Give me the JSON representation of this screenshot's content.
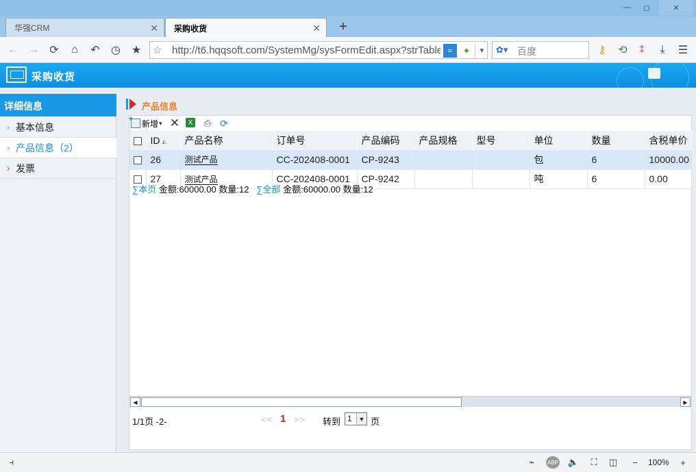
{
  "window": {
    "controls": {
      "minimize": "—",
      "maximize": "◻",
      "close": "✕"
    }
  },
  "tabs": [
    {
      "label": "华强CRM",
      "active": false
    },
    {
      "label": "采购收货",
      "active": true
    }
  ],
  "tab_add": "+",
  "tab_close": "✕",
  "address": {
    "url": "http://t6.hqqsoft.com/SystemMg/sysFormEdit.aspx?strTableName=",
    "search_placeholder": "百度"
  },
  "banner": {
    "title": "采购收货"
  },
  "sidebar": {
    "header": "详细信息",
    "items": [
      {
        "label": "基本信息",
        "active": false
      },
      {
        "label": "产品信息（2）",
        "active": true
      },
      {
        "label": "发票",
        "active": false
      }
    ]
  },
  "section": {
    "title": "产品信息"
  },
  "toolbar": {
    "new_label": "新增"
  },
  "grid": {
    "columns": [
      "ID",
      "产品名称",
      "订单号",
      "产品编码",
      "产品规格",
      "型号",
      "单位",
      "数量",
      "含税单价"
    ],
    "rows": [
      {
        "id": "26",
        "name": "测试产品",
        "order": "CC-202408-0001",
        "code": "CP-9243",
        "spec": "",
        "model": "",
        "unit": "包",
        "qty": "6",
        "price": "10000.00"
      },
      {
        "id": "27",
        "name": "测试产品",
        "order": "CC-202408-0001",
        "code": "CP-9242",
        "spec": "",
        "model": "",
        "unit": "吨",
        "qty": "6",
        "price": "0.00"
      }
    ]
  },
  "summary": {
    "page_label": "∑本页",
    "page_text": "金额:60000.00 数量:12",
    "all_label": "∑全部",
    "all_text": "金额:60000.00 数量:12"
  },
  "pager": {
    "info": "1/1页 -2-",
    "prev": "<<",
    "current": "1",
    "next": ">>",
    "goto_label": "转到",
    "goto_value": "1",
    "unit": "页"
  },
  "status": {
    "zoom": "100%"
  },
  "colors": {
    "accent": "#1a98e6",
    "section_title": "#e8812a",
    "page_current": "#d42020"
  }
}
